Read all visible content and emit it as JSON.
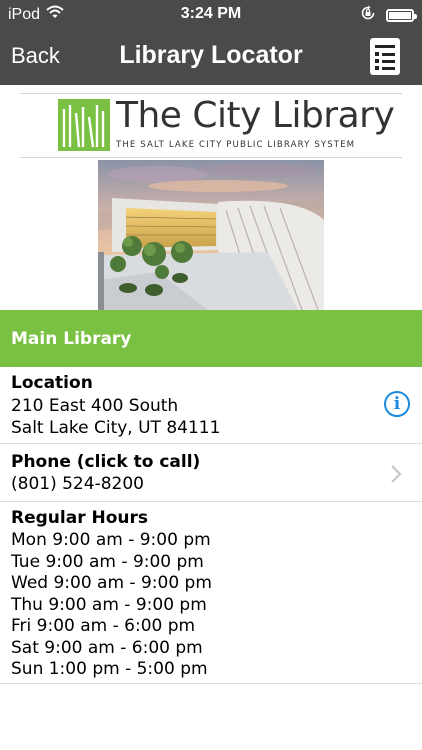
{
  "status_bar": {
    "carrier": "iPod",
    "time": "3:24 PM"
  },
  "nav": {
    "back_label": "Back",
    "title": "Library Locator"
  },
  "logo": {
    "name": "The City Library",
    "tagline": "THE SALT LAKE CITY PUBLIC LIBRARY SYSTEM"
  },
  "branch": {
    "name": "Main Library"
  },
  "location": {
    "heading": "Location",
    "address_line1": "210 East 400 South",
    "address_line2": "Salt Lake City, UT 84111"
  },
  "phone": {
    "heading": "Phone (click to call)",
    "number": "(801) 524-8200"
  },
  "hours": {
    "heading": "Regular Hours",
    "lines": [
      "Mon 9:00 am - 9:00 pm",
      "Tue 9:00 am - 9:00 pm",
      "Wed 9:00 am - 9:00 pm",
      "Thu 9:00 am - 9:00 pm",
      "Fri 9:00 am - 6:00 pm",
      "Sat 9:00 am - 6:00 pm",
      "Sun 1:00 pm - 5:00 pm"
    ]
  },
  "colors": {
    "nav_background": "#4a4a4a",
    "brand_green": "#7ac143",
    "info_blue": "#1a8be0"
  }
}
